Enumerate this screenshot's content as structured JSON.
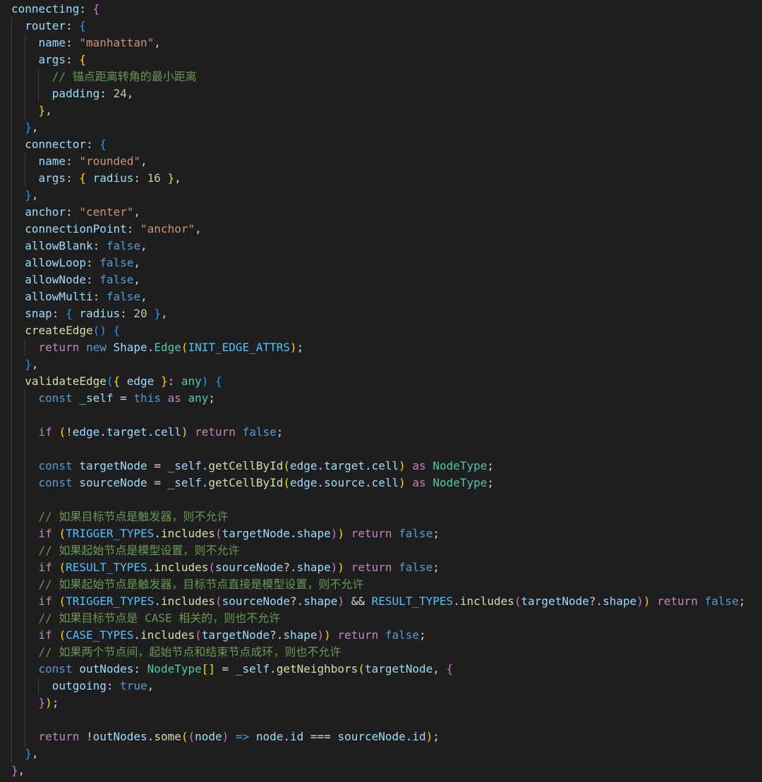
{
  "editor": {
    "language": "typescript",
    "theme": "dark",
    "lines": [
      [
        [
          "connecting",
          "prop"
        ],
        [
          ": ",
          "punc"
        ],
        [
          "{",
          "br2"
        ]
      ],
      [
        [
          "  ",
          "plain"
        ],
        [
          "router",
          "prop"
        ],
        [
          ": ",
          "punc"
        ],
        [
          "{",
          "br3"
        ]
      ],
      [
        [
          "    ",
          "plain"
        ],
        [
          "name",
          "prop"
        ],
        [
          ": ",
          "punc"
        ],
        [
          "\"manhattan\"",
          "str"
        ],
        [
          ",",
          "punc"
        ]
      ],
      [
        [
          "    ",
          "plain"
        ],
        [
          "args",
          "prop"
        ],
        [
          ": ",
          "punc"
        ],
        [
          "{",
          "br1"
        ]
      ],
      [
        [
          "      ",
          "plain"
        ],
        [
          "// 锚点距离转角的最小距离",
          "cmt"
        ]
      ],
      [
        [
          "      ",
          "plain"
        ],
        [
          "padding",
          "prop"
        ],
        [
          ": ",
          "punc"
        ],
        [
          "24",
          "num"
        ],
        [
          ",",
          "punc"
        ]
      ],
      [
        [
          "    ",
          "plain"
        ],
        [
          "}",
          "br1"
        ],
        [
          ",",
          "punc"
        ]
      ],
      [
        [
          "  ",
          "plain"
        ],
        [
          "}",
          "br3"
        ],
        [
          ",",
          "punc"
        ]
      ],
      [
        [
          "  ",
          "plain"
        ],
        [
          "connector",
          "prop"
        ],
        [
          ": ",
          "punc"
        ],
        [
          "{",
          "br3"
        ]
      ],
      [
        [
          "    ",
          "plain"
        ],
        [
          "name",
          "prop"
        ],
        [
          ": ",
          "punc"
        ],
        [
          "\"rounded\"",
          "str"
        ],
        [
          ",",
          "punc"
        ]
      ],
      [
        [
          "    ",
          "plain"
        ],
        [
          "args",
          "prop"
        ],
        [
          ": ",
          "punc"
        ],
        [
          "{",
          "br1"
        ],
        [
          " ",
          "plain"
        ],
        [
          "radius",
          "prop"
        ],
        [
          ": ",
          "punc"
        ],
        [
          "16",
          "num"
        ],
        [
          " ",
          "plain"
        ],
        [
          "}",
          "br1"
        ],
        [
          ",",
          "punc"
        ]
      ],
      [
        [
          "  ",
          "plain"
        ],
        [
          "}",
          "br3"
        ],
        [
          ",",
          "punc"
        ]
      ],
      [
        [
          "  ",
          "plain"
        ],
        [
          "anchor",
          "prop"
        ],
        [
          ": ",
          "punc"
        ],
        [
          "\"center\"",
          "str"
        ],
        [
          ",",
          "punc"
        ]
      ],
      [
        [
          "  ",
          "plain"
        ],
        [
          "connectionPoint",
          "prop"
        ],
        [
          ": ",
          "punc"
        ],
        [
          "\"anchor\"",
          "str"
        ],
        [
          ",",
          "punc"
        ]
      ],
      [
        [
          "  ",
          "plain"
        ],
        [
          "allowBlank",
          "prop"
        ],
        [
          ": ",
          "punc"
        ],
        [
          "false",
          "bool"
        ],
        [
          ",",
          "punc"
        ]
      ],
      [
        [
          "  ",
          "plain"
        ],
        [
          "allowLoop",
          "prop"
        ],
        [
          ": ",
          "punc"
        ],
        [
          "false",
          "bool"
        ],
        [
          ",",
          "punc"
        ]
      ],
      [
        [
          "  ",
          "plain"
        ],
        [
          "allowNode",
          "prop"
        ],
        [
          ": ",
          "punc"
        ],
        [
          "false",
          "bool"
        ],
        [
          ",",
          "punc"
        ]
      ],
      [
        [
          "  ",
          "plain"
        ],
        [
          "allowMulti",
          "prop"
        ],
        [
          ": ",
          "punc"
        ],
        [
          "false",
          "bool"
        ],
        [
          ",",
          "punc"
        ]
      ],
      [
        [
          "  ",
          "plain"
        ],
        [
          "snap",
          "prop"
        ],
        [
          ": ",
          "punc"
        ],
        [
          "{",
          "br3"
        ],
        [
          " ",
          "plain"
        ],
        [
          "radius",
          "prop"
        ],
        [
          ": ",
          "punc"
        ],
        [
          "20",
          "num"
        ],
        [
          " ",
          "plain"
        ],
        [
          "}",
          "br3"
        ],
        [
          ",",
          "punc"
        ]
      ],
      [
        [
          "  ",
          "plain"
        ],
        [
          "createEdge",
          "fn"
        ],
        [
          "()",
          "br3"
        ],
        [
          " ",
          "plain"
        ],
        [
          "{",
          "br3"
        ]
      ],
      [
        [
          "    ",
          "plain"
        ],
        [
          "return",
          "kw"
        ],
        [
          " ",
          "plain"
        ],
        [
          "new",
          "decl"
        ],
        [
          " ",
          "plain"
        ],
        [
          "Shape",
          "var"
        ],
        [
          ".",
          "punc"
        ],
        [
          "Edge",
          "type"
        ],
        [
          "(",
          "br1"
        ],
        [
          "INIT_EDGE_ATTRS",
          "const"
        ],
        [
          ")",
          "br1"
        ],
        [
          ";",
          "punc"
        ]
      ],
      [
        [
          "  ",
          "plain"
        ],
        [
          "}",
          "br3"
        ],
        [
          ",",
          "punc"
        ]
      ],
      [
        [
          "  ",
          "plain"
        ],
        [
          "validateEdge",
          "fn"
        ],
        [
          "(",
          "br3"
        ],
        [
          "{",
          "br1"
        ],
        [
          " ",
          "plain"
        ],
        [
          "edge",
          "var"
        ],
        [
          " ",
          "plain"
        ],
        [
          "}",
          "br1"
        ],
        [
          ": ",
          "punc"
        ],
        [
          "any",
          "type"
        ],
        [
          ")",
          "br3"
        ],
        [
          " ",
          "plain"
        ],
        [
          "{",
          "br3"
        ]
      ],
      [
        [
          "    ",
          "plain"
        ],
        [
          "const",
          "decl"
        ],
        [
          " ",
          "plain"
        ],
        [
          "_self",
          "var"
        ],
        [
          " = ",
          "punc"
        ],
        [
          "this",
          "decl"
        ],
        [
          " ",
          "plain"
        ],
        [
          "as",
          "kw"
        ],
        [
          " ",
          "plain"
        ],
        [
          "any",
          "type"
        ],
        [
          ";",
          "punc"
        ]
      ],
      [],
      [
        [
          "    ",
          "plain"
        ],
        [
          "if",
          "kw"
        ],
        [
          " ",
          "plain"
        ],
        [
          "(",
          "br1"
        ],
        [
          "!",
          "punc"
        ],
        [
          "edge",
          "var"
        ],
        [
          ".",
          "punc"
        ],
        [
          "target",
          "var"
        ],
        [
          ".",
          "punc"
        ],
        [
          "cell",
          "var"
        ],
        [
          ")",
          "br1"
        ],
        [
          " ",
          "plain"
        ],
        [
          "return",
          "kw"
        ],
        [
          " ",
          "plain"
        ],
        [
          "false",
          "bool"
        ],
        [
          ";",
          "punc"
        ]
      ],
      [],
      [
        [
          "    ",
          "plain"
        ],
        [
          "const",
          "decl"
        ],
        [
          " ",
          "plain"
        ],
        [
          "targetNode",
          "var"
        ],
        [
          " = ",
          "punc"
        ],
        [
          "_self",
          "var"
        ],
        [
          ".",
          "punc"
        ],
        [
          "getCellById",
          "fn"
        ],
        [
          "(",
          "br1"
        ],
        [
          "edge",
          "var"
        ],
        [
          ".",
          "punc"
        ],
        [
          "target",
          "var"
        ],
        [
          ".",
          "punc"
        ],
        [
          "cell",
          "var"
        ],
        [
          ")",
          "br1"
        ],
        [
          " ",
          "plain"
        ],
        [
          "as",
          "kw"
        ],
        [
          " ",
          "plain"
        ],
        [
          "NodeType",
          "type"
        ],
        [
          ";",
          "punc"
        ]
      ],
      [
        [
          "    ",
          "plain"
        ],
        [
          "const",
          "decl"
        ],
        [
          " ",
          "plain"
        ],
        [
          "sourceNode",
          "var"
        ],
        [
          " = ",
          "punc"
        ],
        [
          "_self",
          "var"
        ],
        [
          ".",
          "punc"
        ],
        [
          "getCellById",
          "fn"
        ],
        [
          "(",
          "br1"
        ],
        [
          "edge",
          "var"
        ],
        [
          ".",
          "punc"
        ],
        [
          "source",
          "var"
        ],
        [
          ".",
          "punc"
        ],
        [
          "cell",
          "var"
        ],
        [
          ")",
          "br1"
        ],
        [
          " ",
          "plain"
        ],
        [
          "as",
          "kw"
        ],
        [
          " ",
          "plain"
        ],
        [
          "NodeType",
          "type"
        ],
        [
          ";",
          "punc"
        ]
      ],
      [],
      [
        [
          "    ",
          "plain"
        ],
        [
          "// 如果目标节点是触发器，则不允许",
          "cmt"
        ]
      ],
      [
        [
          "    ",
          "plain"
        ],
        [
          "if",
          "kw"
        ],
        [
          " ",
          "plain"
        ],
        [
          "(",
          "br1"
        ],
        [
          "TRIGGER_TYPES",
          "const"
        ],
        [
          ".",
          "punc"
        ],
        [
          "includes",
          "fn"
        ],
        [
          "(",
          "br2"
        ],
        [
          "targetNode",
          "var"
        ],
        [
          ".",
          "punc"
        ],
        [
          "shape",
          "var"
        ],
        [
          ")",
          "br2"
        ],
        [
          ")",
          "br1"
        ],
        [
          " ",
          "plain"
        ],
        [
          "return",
          "kw"
        ],
        [
          " ",
          "plain"
        ],
        [
          "false",
          "bool"
        ],
        [
          ";",
          "punc"
        ]
      ],
      [
        [
          "    ",
          "plain"
        ],
        [
          "// 如果起始节点是模型设置，则不允许",
          "cmt"
        ]
      ],
      [
        [
          "    ",
          "plain"
        ],
        [
          "if",
          "kw"
        ],
        [
          " ",
          "plain"
        ],
        [
          "(",
          "br1"
        ],
        [
          "RESULT_TYPES",
          "const"
        ],
        [
          ".",
          "punc"
        ],
        [
          "includes",
          "fn"
        ],
        [
          "(",
          "br2"
        ],
        [
          "sourceNode",
          "var"
        ],
        [
          "?.",
          "punc"
        ],
        [
          "shape",
          "var"
        ],
        [
          ")",
          "br2"
        ],
        [
          ")",
          "br1"
        ],
        [
          " ",
          "plain"
        ],
        [
          "return",
          "kw"
        ],
        [
          " ",
          "plain"
        ],
        [
          "false",
          "bool"
        ],
        [
          ";",
          "punc"
        ]
      ],
      [
        [
          "    ",
          "plain"
        ],
        [
          "// 如果起始节点是触发器，目标节点直接是模型设置，则不允许",
          "cmt"
        ]
      ],
      [
        [
          "    ",
          "plain"
        ],
        [
          "if",
          "kw"
        ],
        [
          " ",
          "plain"
        ],
        [
          "(",
          "br1"
        ],
        [
          "TRIGGER_TYPES",
          "const"
        ],
        [
          ".",
          "punc"
        ],
        [
          "includes",
          "fn"
        ],
        [
          "(",
          "br2"
        ],
        [
          "sourceNode",
          "var"
        ],
        [
          "?.",
          "punc"
        ],
        [
          "shape",
          "var"
        ],
        [
          ")",
          "br2"
        ],
        [
          " && ",
          "punc"
        ],
        [
          "RESULT_TYPES",
          "const"
        ],
        [
          ".",
          "punc"
        ],
        [
          "includes",
          "fn"
        ],
        [
          "(",
          "br2"
        ],
        [
          "targetNode",
          "var"
        ],
        [
          "?.",
          "punc"
        ],
        [
          "shape",
          "var"
        ],
        [
          ")",
          "br2"
        ],
        [
          ")",
          "br1"
        ],
        [
          " ",
          "plain"
        ],
        [
          "return",
          "kw"
        ],
        [
          " ",
          "plain"
        ],
        [
          "false",
          "bool"
        ],
        [
          ";",
          "punc"
        ]
      ],
      [
        [
          "    ",
          "plain"
        ],
        [
          "// 如果目标节点是 CASE 相关的，则也不允许",
          "cmt"
        ]
      ],
      [
        [
          "    ",
          "plain"
        ],
        [
          "if",
          "kw"
        ],
        [
          " ",
          "plain"
        ],
        [
          "(",
          "br1"
        ],
        [
          "CASE_TYPES",
          "const"
        ],
        [
          ".",
          "punc"
        ],
        [
          "includes",
          "fn"
        ],
        [
          "(",
          "br2"
        ],
        [
          "targetNode",
          "var"
        ],
        [
          "?.",
          "punc"
        ],
        [
          "shape",
          "var"
        ],
        [
          ")",
          "br2"
        ],
        [
          ")",
          "br1"
        ],
        [
          " ",
          "plain"
        ],
        [
          "return",
          "kw"
        ],
        [
          " ",
          "plain"
        ],
        [
          "false",
          "bool"
        ],
        [
          ";",
          "punc"
        ]
      ],
      [
        [
          "    ",
          "plain"
        ],
        [
          "// 如果两个节点间，起始节点和结束节点成环，则也不允许",
          "cmt"
        ]
      ],
      [
        [
          "    ",
          "plain"
        ],
        [
          "const",
          "decl"
        ],
        [
          " ",
          "plain"
        ],
        [
          "outNodes",
          "var"
        ],
        [
          ": ",
          "punc"
        ],
        [
          "NodeType",
          "type"
        ],
        [
          "[]",
          "br1"
        ],
        [
          " = ",
          "punc"
        ],
        [
          "_self",
          "var"
        ],
        [
          ".",
          "punc"
        ],
        [
          "getNeighbors",
          "fn"
        ],
        [
          "(",
          "br1"
        ],
        [
          "targetNode",
          "var"
        ],
        [
          ", ",
          "punc"
        ],
        [
          "{",
          "br2"
        ]
      ],
      [
        [
          "      ",
          "plain"
        ],
        [
          "outgoing",
          "prop"
        ],
        [
          ": ",
          "punc"
        ],
        [
          "true",
          "bool"
        ],
        [
          ",",
          "punc"
        ]
      ],
      [
        [
          "    ",
          "plain"
        ],
        [
          "}",
          "br2"
        ],
        [
          ")",
          "br1"
        ],
        [
          ";",
          "punc"
        ]
      ],
      [],
      [
        [
          "    ",
          "plain"
        ],
        [
          "return",
          "kw"
        ],
        [
          " ",
          "plain"
        ],
        [
          "!",
          "punc"
        ],
        [
          "outNodes",
          "var"
        ],
        [
          ".",
          "punc"
        ],
        [
          "some",
          "fn"
        ],
        [
          "(",
          "br1"
        ],
        [
          "(",
          "br2"
        ],
        [
          "node",
          "var"
        ],
        [
          ")",
          "br2"
        ],
        [
          " ",
          "plain"
        ],
        [
          "=>",
          "decl"
        ],
        [
          " ",
          "plain"
        ],
        [
          "node",
          "var"
        ],
        [
          ".",
          "punc"
        ],
        [
          "id",
          "var"
        ],
        [
          " === ",
          "punc"
        ],
        [
          "sourceNode",
          "var"
        ],
        [
          ".",
          "punc"
        ],
        [
          "id",
          "var"
        ],
        [
          ")",
          "br1"
        ],
        [
          ";",
          "punc"
        ]
      ],
      [
        [
          "  ",
          "plain"
        ],
        [
          "}",
          "br3"
        ],
        [
          ",",
          "punc"
        ]
      ],
      [
        [
          "}",
          "br2"
        ],
        [
          ",",
          "punc"
        ]
      ]
    ]
  }
}
